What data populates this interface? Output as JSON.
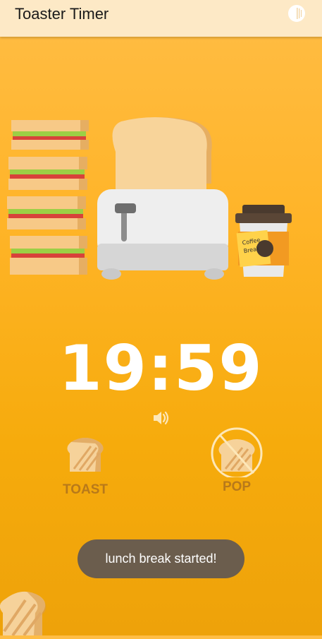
{
  "appbar": {
    "title": "Toaster Timer",
    "theme_icon": "half-circle-theme-icon"
  },
  "scene": {
    "sandwich": "sandwich-stack-illustration",
    "toaster": "toaster-illustration",
    "coffee": "coffee-cup-illustration",
    "coffee_label_line1": "Coffee",
    "coffee_label_line2": "Break"
  },
  "timer": {
    "display": "19:59"
  },
  "sound": {
    "icon": "speaker-icon"
  },
  "actions": {
    "toast_label": "TOAST",
    "pop_label": "POP"
  },
  "snackbar": {
    "message": "lunch break started!"
  },
  "colors": {
    "appbar_bg": "#fde9c6",
    "background_top": "#ffbd45",
    "background_bottom": "#eea20a",
    "timer_text": "#ffffff",
    "action_label": "#b8791a",
    "snackbar_bg": "#6b5d4d"
  }
}
